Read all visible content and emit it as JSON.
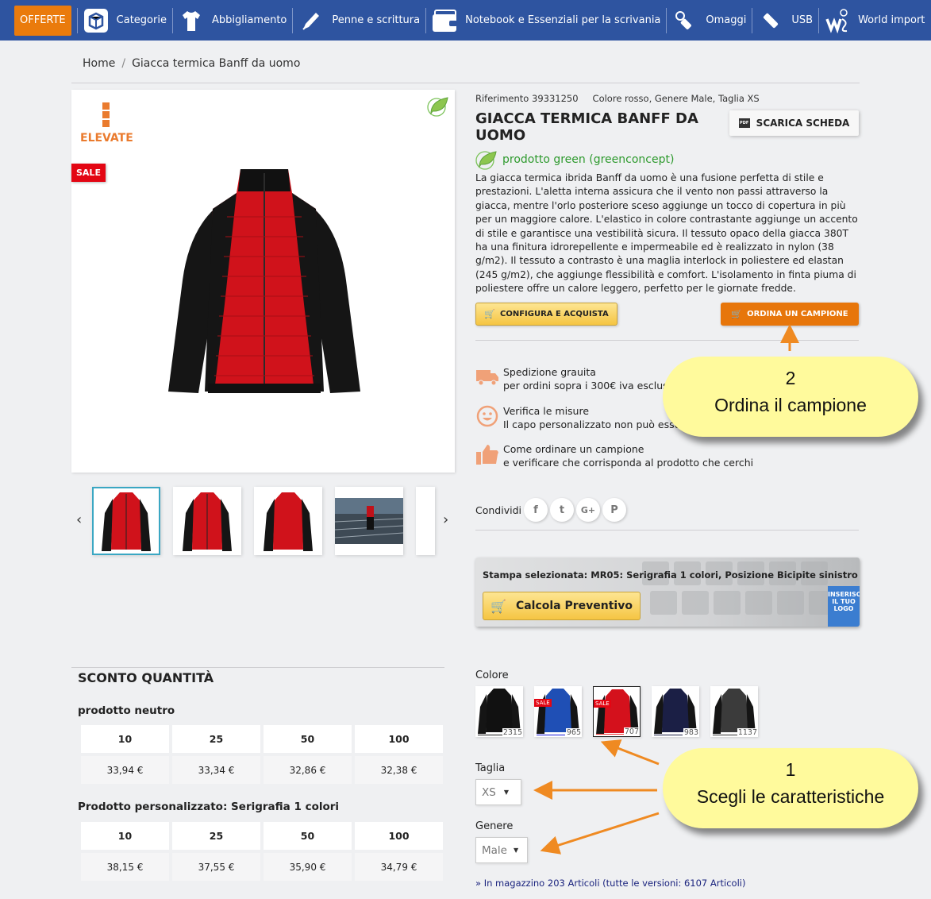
{
  "nav": {
    "offerte": "OFFERTE",
    "items": [
      {
        "label": "Categorie",
        "icon": "box-icon"
      },
      {
        "label": "Abbigliamento",
        "icon": "tshirt-icon"
      },
      {
        "label": "Penne e scrittura",
        "icon": "pen-icon"
      },
      {
        "label": "Notebook e Essenziali per la scrivania",
        "icon": "wallet-icon"
      },
      {
        "label": "Omaggi",
        "icon": "keychain-icon"
      },
      {
        "label": "USB",
        "icon": "usb-icon"
      },
      {
        "label": "World import",
        "icon": "world-import-icon"
      }
    ]
  },
  "breadcrumb": {
    "home": "Home",
    "separator": "/",
    "current": "Giacca termica Banff da uomo"
  },
  "gallery": {
    "brand": "ELEVATE",
    "sale_badge": "SALE",
    "prev": "‹",
    "next": "›",
    "thumbs": [
      "front",
      "front-2",
      "back",
      "lifestyle",
      "partial"
    ]
  },
  "product": {
    "reference": "Riferimento 39331250",
    "variant": "Colore rosso, Genere Male, Taglia XS",
    "title": "GIACCA TERMICA BANFF DA UOMO",
    "download_label": "SCARICA SCHEDA",
    "pdf_icon_text": "PDF",
    "green_label": "prodotto green (greenconcept)",
    "description": "La giacca termica ibrida Banff da uomo è una fusione perfetta di stile e prestazioni. L'aletta interna assicura che il vento non passi attraverso la giacca, mentre l'orlo posteriore sceso aggiunge un tocco di copertura in più per un maggiore calore. L'elastico in colore contrastante aggiunge un accento di stile e garantisce una vestibilità sicura. Il tessuto opaco della giacca 380T ha una finitura idrorepellente e impermeabile ed è realizzato in nylon (38 g/m2). Il tessuto a contrasto è una maglia interlock in poliestere ed elastan (245 g/m2), che aggiunge flessibilità e comfort. L'isolamento in finta piuma di poliestere offre un calore leggero, perfetto per le giornate fredde.",
    "configure_label": "CONFIGURA E ACQUISTA",
    "sample_label": "ORDINA UN CAMPIONE"
  },
  "info": [
    {
      "title": "Spedizione grauita",
      "text": "per ordini sopra i 300€ iva esclusa",
      "icon": "truck-icon"
    },
    {
      "title": "Verifica le misure",
      "text": "Il capo personalizzato non può esse",
      "icon": "smiley-icon"
    },
    {
      "title": "Come ordinare un campione",
      "text": "e verificare che corrisponda al prodotto che cerchi",
      "icon": "thumbs-up-icon"
    }
  ],
  "share": {
    "label": "Condividi",
    "networks": [
      "f",
      "t",
      "G+",
      "P"
    ]
  },
  "print": {
    "selected": "Stampa selezionata: MR05: Serigrafia 1 colori, Posizione Bicipite sinistro",
    "calc_label": "Calcola Preventivo",
    "logo_key_text": "INSERISCI IL TUO LOGO"
  },
  "discount": {
    "title": "SCONTO QUANTITÀ",
    "tables": [
      {
        "title": "prodotto neutro",
        "quantities": [
          "10",
          "25",
          "50",
          "100"
        ],
        "prices": [
          "33,94 €",
          "33,34 €",
          "32,86 €",
          "32,38 €"
        ]
      },
      {
        "title": "Prodotto personalizzato: Serigrafia 1 colori",
        "quantities": [
          "10",
          "25",
          "50",
          "100"
        ],
        "prices": [
          "38,15 €",
          "37,55 €",
          "35,90 €",
          "34,79 €"
        ]
      }
    ]
  },
  "options": {
    "color_label": "Colore",
    "swatches": [
      {
        "name": "nero",
        "count": "2315",
        "sale": "",
        "color": "#111111",
        "accent": "#1a1a1a"
      },
      {
        "name": "blu royal",
        "count": "965",
        "sale": "SALE",
        "color": "#1f4fb5",
        "accent": "#1a1adb"
      },
      {
        "name": "rosso",
        "count": "707",
        "sale": "SALE",
        "color": "#d4111c",
        "accent": "#e33"
      },
      {
        "name": "blu navy",
        "count": "983",
        "sale": "",
        "color": "#1b1f45",
        "accent": "#1b1f45"
      },
      {
        "name": "grigio",
        "count": "1137",
        "sale": "",
        "color": "#3b3b3b",
        "accent": "#333"
      }
    ],
    "size_label": "Taglia",
    "size_value": "XS",
    "gender_label": "Genere",
    "gender_value": "Male",
    "stock": "» In magazzino 203 Articoli (tutte le versioni: 6107 Articoli)"
  },
  "callouts": [
    {
      "number": "2",
      "text": "Ordina il campione"
    },
    {
      "number": "1",
      "text": "Scegli le caratteristiche"
    }
  ],
  "colors": {
    "nav": "#2e54a0",
    "offerte": "#ea7b0c",
    "sample_button": "#e7760b",
    "callout": "#fffa9c",
    "arrow": "#ef8a22",
    "green": "#2e9a2e"
  }
}
